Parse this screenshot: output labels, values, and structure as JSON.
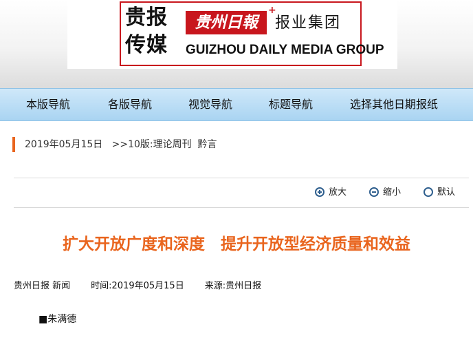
{
  "logo": {
    "brand_cn": "贵报传媒",
    "paper_name": "贵州日報",
    "plus": "+",
    "group_cn": "报业集团",
    "group_en": "GUIZHOU DAILY MEDIA GROUP"
  },
  "nav": {
    "items": [
      {
        "label": "本版导航"
      },
      {
        "label": "各版导航"
      },
      {
        "label": "视觉导航"
      },
      {
        "label": "标题导航"
      },
      {
        "label": "选择其他日期报纸"
      }
    ]
  },
  "breadcrumb": {
    "date": "2019年05月15日",
    "section": ">>10版:理论周刊  黔言"
  },
  "toolbar": {
    "zoom_in": "放大",
    "zoom_out": "缩小",
    "default": "默认"
  },
  "article": {
    "title": "扩大开放广度和深度　提升开放型经济质量和效益",
    "source_label": "贵州日报 新闻",
    "time_label": "时间:2019年05月15日",
    "origin_label": "来源:贵州日报",
    "author": "■朱满德"
  },
  "colors": {
    "accent_orange": "#e9651e",
    "brand_red": "#c8161d",
    "nav_blue": "#a9d4f2"
  }
}
